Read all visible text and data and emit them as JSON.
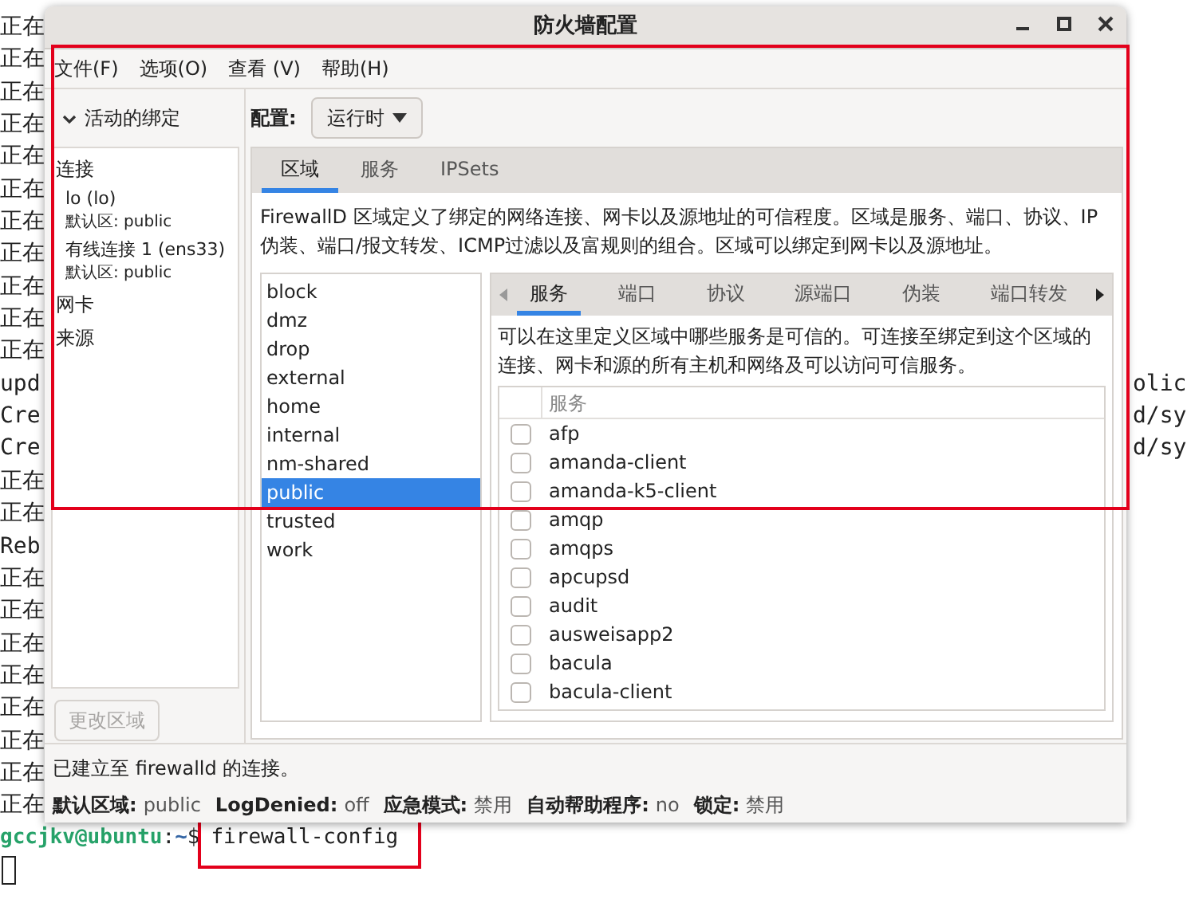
{
  "terminal": {
    "lines": [
      {
        "left": "正在"
      },
      {
        "left": "正在"
      },
      {
        "left": "正在"
      },
      {
        "left": "正在"
      },
      {
        "left": "正在"
      },
      {
        "left": "正在"
      },
      {
        "left": "正在"
      },
      {
        "left": "正在"
      },
      {
        "left": "正在"
      },
      {
        "left": "正在"
      },
      {
        "left": "正在"
      },
      {
        "left": "upd",
        "right": "olic"
      },
      {
        "left": "Cre",
        "right": "d/sy"
      },
      {
        "left": "Cre",
        "right": "d/sy"
      },
      {
        "left": "正在"
      },
      {
        "left": "正在"
      },
      {
        "left": "Reb"
      },
      {
        "left": "正在"
      },
      {
        "left": "正在"
      },
      {
        "left": "正在"
      },
      {
        "left": "正在"
      },
      {
        "left": "正在"
      },
      {
        "left": "正在"
      },
      {
        "left": "正在"
      },
      {
        "left": "正在"
      }
    ],
    "prompt": {
      "user": "gccjkv@ubuntu",
      "separator": ":",
      "path": "~",
      "symbol": "$",
      "command": "firewall-config"
    }
  },
  "window": {
    "title": "防火墙配置"
  },
  "menu": [
    "文件(F)",
    "选项(O)",
    "查看 (V)",
    "帮助(H)"
  ],
  "bindings": {
    "header": "活动的绑定",
    "expanded": true,
    "groups": [
      {
        "label": "连接",
        "items": [
          {
            "name": "lo (lo)",
            "zone": "默认区: public"
          },
          {
            "name": "有线连接 1 (ens33)",
            "zone": "默认区: public"
          }
        ]
      },
      {
        "label": "网卡"
      },
      {
        "label": "来源"
      }
    ]
  },
  "change_zone_button": {
    "label": "更改区域",
    "disabled": true
  },
  "config": {
    "label": "配置:",
    "value": "运行时"
  },
  "tabs": [
    {
      "label": "区域",
      "selected": true
    },
    {
      "label": "服务",
      "selected": false
    },
    {
      "label": "IPSets",
      "selected": false
    }
  ],
  "zone_description": "FirewallD 区域定义了绑定的网络连接、网卡以及源地址的可信程度。区域是服务、端口、协议、IP伪装、端口/报文转发、ICMP过滤以及富规则的组合。区域可以绑定到网卡以及源地址。",
  "zones": [
    {
      "name": "block",
      "selected": false
    },
    {
      "name": "dmz",
      "selected": false
    },
    {
      "name": "drop",
      "selected": false
    },
    {
      "name": "external",
      "selected": false
    },
    {
      "name": "home",
      "selected": false
    },
    {
      "name": "internal",
      "selected": false
    },
    {
      "name": "nm-shared",
      "selected": false
    },
    {
      "name": "public",
      "selected": true
    },
    {
      "name": "trusted",
      "selected": false
    },
    {
      "name": "work",
      "selected": false
    }
  ],
  "zone_tabs": [
    {
      "label": "服务",
      "selected": true
    },
    {
      "label": "端口",
      "selected": false
    },
    {
      "label": "协议",
      "selected": false
    },
    {
      "label": "源端口",
      "selected": false
    },
    {
      "label": "伪装",
      "selected": false
    },
    {
      "label": "端口转发",
      "selected": false
    }
  ],
  "service_description": "可以在这里定义区域中哪些服务是可信的。可连接至绑定到这个区域的连接、网卡和源的所有主机和网络及可以访问可信服务。",
  "services": {
    "column": "服务",
    "items": [
      {
        "name": "afp",
        "checked": false
      },
      {
        "name": "amanda-client",
        "checked": false
      },
      {
        "name": "amanda-k5-client",
        "checked": false
      },
      {
        "name": "amqp",
        "checked": false
      },
      {
        "name": "amqps",
        "checked": false
      },
      {
        "name": "apcupsd",
        "checked": false
      },
      {
        "name": "audit",
        "checked": false
      },
      {
        "name": "ausweisapp2",
        "checked": false
      },
      {
        "name": "bacula",
        "checked": false
      },
      {
        "name": "bacula-client",
        "checked": false
      }
    ]
  },
  "status": {
    "message": "已建立至 firewalld 的连接。",
    "fields": [
      {
        "label": "默认区域:",
        "value": "public"
      },
      {
        "label": "LogDenied:",
        "value": "off"
      },
      {
        "label": "应急模式:",
        "value": "禁用"
      },
      {
        "label": "自动帮助程序:",
        "value": "no"
      },
      {
        "label": "锁定:",
        "value": "禁用"
      }
    ]
  }
}
